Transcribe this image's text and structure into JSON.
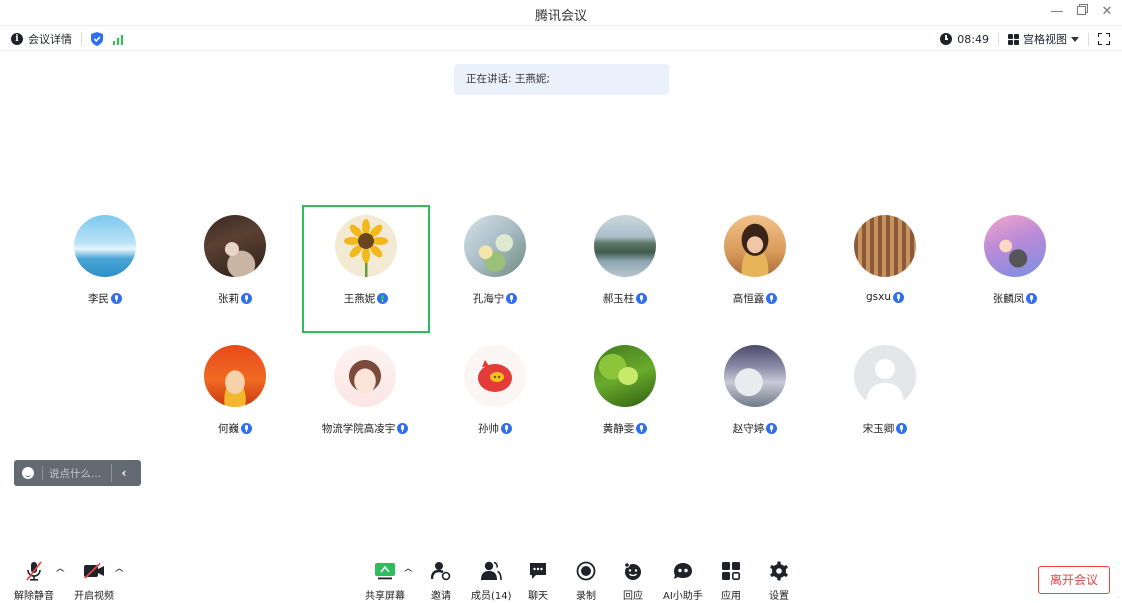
{
  "app": {
    "title": "腾讯会议"
  },
  "infobar": {
    "meeting_details": "会议详情",
    "timer": "08:49",
    "view_mode": "宫格视图"
  },
  "speaking_banner": "正在讲话: 王燕妮;",
  "participants": [
    {
      "name": "李民"
    },
    {
      "name": "张莉"
    },
    {
      "name": "王燕妮"
    },
    {
      "name": "孔海宁"
    },
    {
      "name": "郝玉柱"
    },
    {
      "name": "高恒露"
    },
    {
      "name": "gsxu"
    },
    {
      "name": "张麟凤"
    },
    {
      "name": "何巍"
    },
    {
      "name": "物流学院高凌宇"
    },
    {
      "name": "孙帅"
    },
    {
      "name": "黄静雯"
    },
    {
      "name": "赵守婷"
    },
    {
      "name": "宋玉卿"
    }
  ],
  "chat": {
    "placeholder": "说点什么..."
  },
  "toolbar": {
    "unmute": "解除静音",
    "start_video": "开启视频",
    "share_screen": "共享屏幕",
    "invite": "邀请",
    "members": "成员(14)",
    "chat": "聊天",
    "record": "录制",
    "reactions": "回应",
    "ai_assistant": "AI小助手",
    "apps": "应用",
    "settings": "设置",
    "leave": "离开会议"
  },
  "colors": {
    "accent": "#2f6ff0",
    "speaking_border": "#2dbd5c",
    "leave": "#e84545",
    "banner_bg": "#eaf1fd"
  }
}
